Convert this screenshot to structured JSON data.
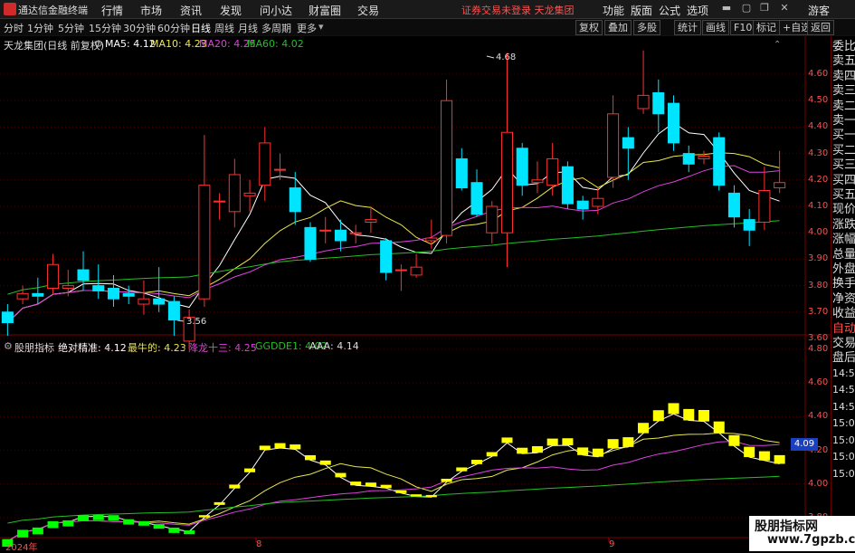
{
  "app": {
    "title": "通达信金融终端",
    "notice": "证券交易未登录  天龙集团",
    "guest": "游客"
  },
  "menu": [
    "行情",
    "市场",
    "资讯",
    "发现",
    "问小达",
    "财富圈",
    "交易"
  ],
  "menu_right": [
    "功能",
    "版面",
    "公式",
    "选项"
  ],
  "periods": [
    "分时",
    "1分钟",
    "5分钟",
    "15分钟",
    "30分钟",
    "60分钟",
    "日线",
    "周线",
    "月线",
    "多周期",
    "更多"
  ],
  "active_period": "日线",
  "tools": [
    "复权",
    "叠加",
    "多股",
    "统计",
    "画线",
    "F10",
    "标记",
    "+自选",
    "返回"
  ],
  "main_info": {
    "name": "天龙集团(日线 前复权)",
    "ma5": "MA5: 4.12",
    "ma10": "MA10: 4.23",
    "ma20": "MA20: 4.25",
    "ma60": "MA60: 4.02"
  },
  "sub_info": {
    "name": "股朋指标",
    "a": "绝对精准: 4.12",
    "b": "最牛的: 4.23",
    "c": "降龙十三: 4.25",
    "d": "GGDDE1: 4.02",
    "e": "AAA: 4.14"
  },
  "price_ticks": [
    "4.60",
    "4.50",
    "4.40",
    "4.30",
    "4.20",
    "4.10",
    "4.00",
    "3.90",
    "3.80",
    "3.70",
    "3.60"
  ],
  "sub_ticks": [
    "4.80",
    "4.60",
    "4.40",
    "4.20",
    "4.00",
    "3.80"
  ],
  "sub_current": "4.09",
  "high_label": "4.68",
  "low_label": "3.56",
  "date_labels": [
    "2024年",
    "8",
    "9"
  ],
  "right_panel": [
    "委比",
    "卖五",
    "卖四",
    "卖三",
    "卖二",
    "卖一",
    "买一",
    "买二",
    "买三",
    "买四",
    "买五",
    "现价",
    "涨跌",
    "涨幅",
    "总量",
    "外盘",
    "换手",
    "净资",
    "收益",
    "自动",
    "交易",
    "盘后",
    "14:56",
    "14:56",
    "14:57",
    "15:00",
    "15:00",
    "15:00",
    "15:00"
  ],
  "watermark": {
    "line1": "股朋指标网",
    "line2": "www.7gpzb.com"
  },
  "colors": {
    "up": "#ff3030",
    "down": "#00e5ff",
    "ma5": "#ffffff",
    "ma10": "#e8e84a",
    "ma20": "#e040e0",
    "ma60": "#22c022",
    "bar_pos": "#ffff00",
    "bar_neg": "#00ff00"
  },
  "chart_data": {
    "type": "candlestick",
    "candles": [
      [
        3.7,
        3.66,
        3.73,
        3.61
      ],
      [
        3.75,
        3.77,
        3.8,
        3.73
      ],
      [
        3.77,
        3.76,
        3.83,
        3.73
      ],
      [
        3.79,
        3.88,
        3.92,
        3.77
      ],
      [
        3.79,
        3.8,
        3.86,
        3.76
      ],
      [
        3.86,
        3.82,
        3.93,
        3.78
      ],
      [
        3.8,
        3.78,
        3.88,
        3.75
      ],
      [
        3.79,
        3.75,
        3.84,
        3.72
      ],
      [
        3.77,
        3.76,
        3.8,
        3.73
      ],
      [
        3.73,
        3.75,
        3.82,
        3.69
      ],
      [
        3.75,
        3.73,
        3.87,
        3.7
      ],
      [
        3.74,
        3.67,
        3.76,
        3.61
      ],
      [
        3.59,
        3.68,
        3.71,
        3.56
      ],
      [
        3.75,
        4.18,
        4.37,
        3.72
      ],
      [
        4.12,
        4.12,
        4.15,
        4.05
      ],
      [
        4.08,
        4.22,
        4.28,
        4.02
      ],
      [
        4.14,
        4.15,
        4.2,
        4.08
      ],
      [
        4.18,
        4.34,
        4.4,
        4.12
      ],
      [
        4.24,
        4.24,
        4.3,
        4.2
      ],
      [
        4.17,
        4.08,
        4.23,
        4.03
      ],
      [
        4.02,
        3.9,
        4.04,
        3.89
      ],
      [
        4.01,
        4.01,
        4.06,
        3.96
      ],
      [
        4.01,
        3.97,
        4.05,
        3.93
      ],
      [
        4.0,
        4.0,
        4.03,
        3.96
      ],
      [
        4.04,
        4.05,
        4.1,
        4.0
      ],
      [
        3.97,
        3.85,
        3.98,
        3.82
      ],
      [
        3.86,
        3.86,
        3.88,
        3.78
      ],
      [
        3.84,
        3.87,
        3.92,
        3.83
      ],
      [
        3.97,
        3.98,
        4.05,
        3.94
      ],
      [
        3.99,
        4.5,
        4.58,
        3.96
      ],
      [
        4.28,
        4.17,
        4.32,
        4.16
      ],
      [
        4.19,
        4.07,
        4.24,
        4.06
      ],
      [
        4.0,
        4.1,
        4.12,
        3.96
      ],
      [
        4.0,
        4.38,
        4.68,
        3.87
      ],
      [
        4.32,
        4.18,
        4.34,
        4.14
      ],
      [
        4.19,
        4.2,
        4.27,
        4.15
      ],
      [
        4.18,
        4.28,
        4.34,
        4.14
      ],
      [
        4.25,
        4.11,
        4.27,
        4.09
      ],
      [
        4.12,
        4.09,
        4.14,
        4.05
      ],
      [
        4.1,
        4.13,
        4.17,
        4.07
      ],
      [
        4.21,
        4.45,
        4.52,
        4.17
      ],
      [
        4.36,
        4.32,
        4.4,
        4.2
      ],
      [
        4.47,
        4.52,
        4.69,
        4.45
      ],
      [
        4.53,
        4.45,
        4.58,
        4.38
      ],
      [
        4.49,
        4.34,
        4.52,
        4.31
      ],
      [
        4.3,
        4.26,
        4.33,
        4.23
      ],
      [
        4.28,
        4.29,
        4.31,
        4.26
      ],
      [
        4.36,
        4.18,
        4.38,
        4.16
      ],
      [
        4.15,
        4.06,
        4.18,
        4.02
      ],
      [
        4.05,
        4.01,
        4.09,
        3.95
      ],
      [
        4.04,
        4.16,
        4.25,
        4.01
      ],
      [
        4.17,
        4.19,
        4.31,
        4.15
      ]
    ],
    "sub_bars": [
      -0.1,
      -0.1,
      -0.09,
      -0.09,
      -0.08,
      -0.08,
      -0.07,
      -0.07,
      -0.07,
      -0.06,
      -0.06,
      -0.07,
      -0.05,
      0.04,
      0.05,
      0.07,
      0.07,
      0.08,
      0.09,
      0.09,
      0.09,
      0.08,
      0.08,
      0.07,
      0.07,
      0.06,
      0.05,
      0.04,
      0.04,
      0.06,
      0.07,
      0.08,
      0.08,
      0.1,
      0.11,
      0.12,
      0.13,
      0.13,
      0.14,
      0.15,
      0.17,
      0.18,
      0.19,
      0.2,
      0.2,
      0.21,
      0.21,
      0.21,
      0.2,
      0.19,
      0.17,
      0.16
    ]
  }
}
